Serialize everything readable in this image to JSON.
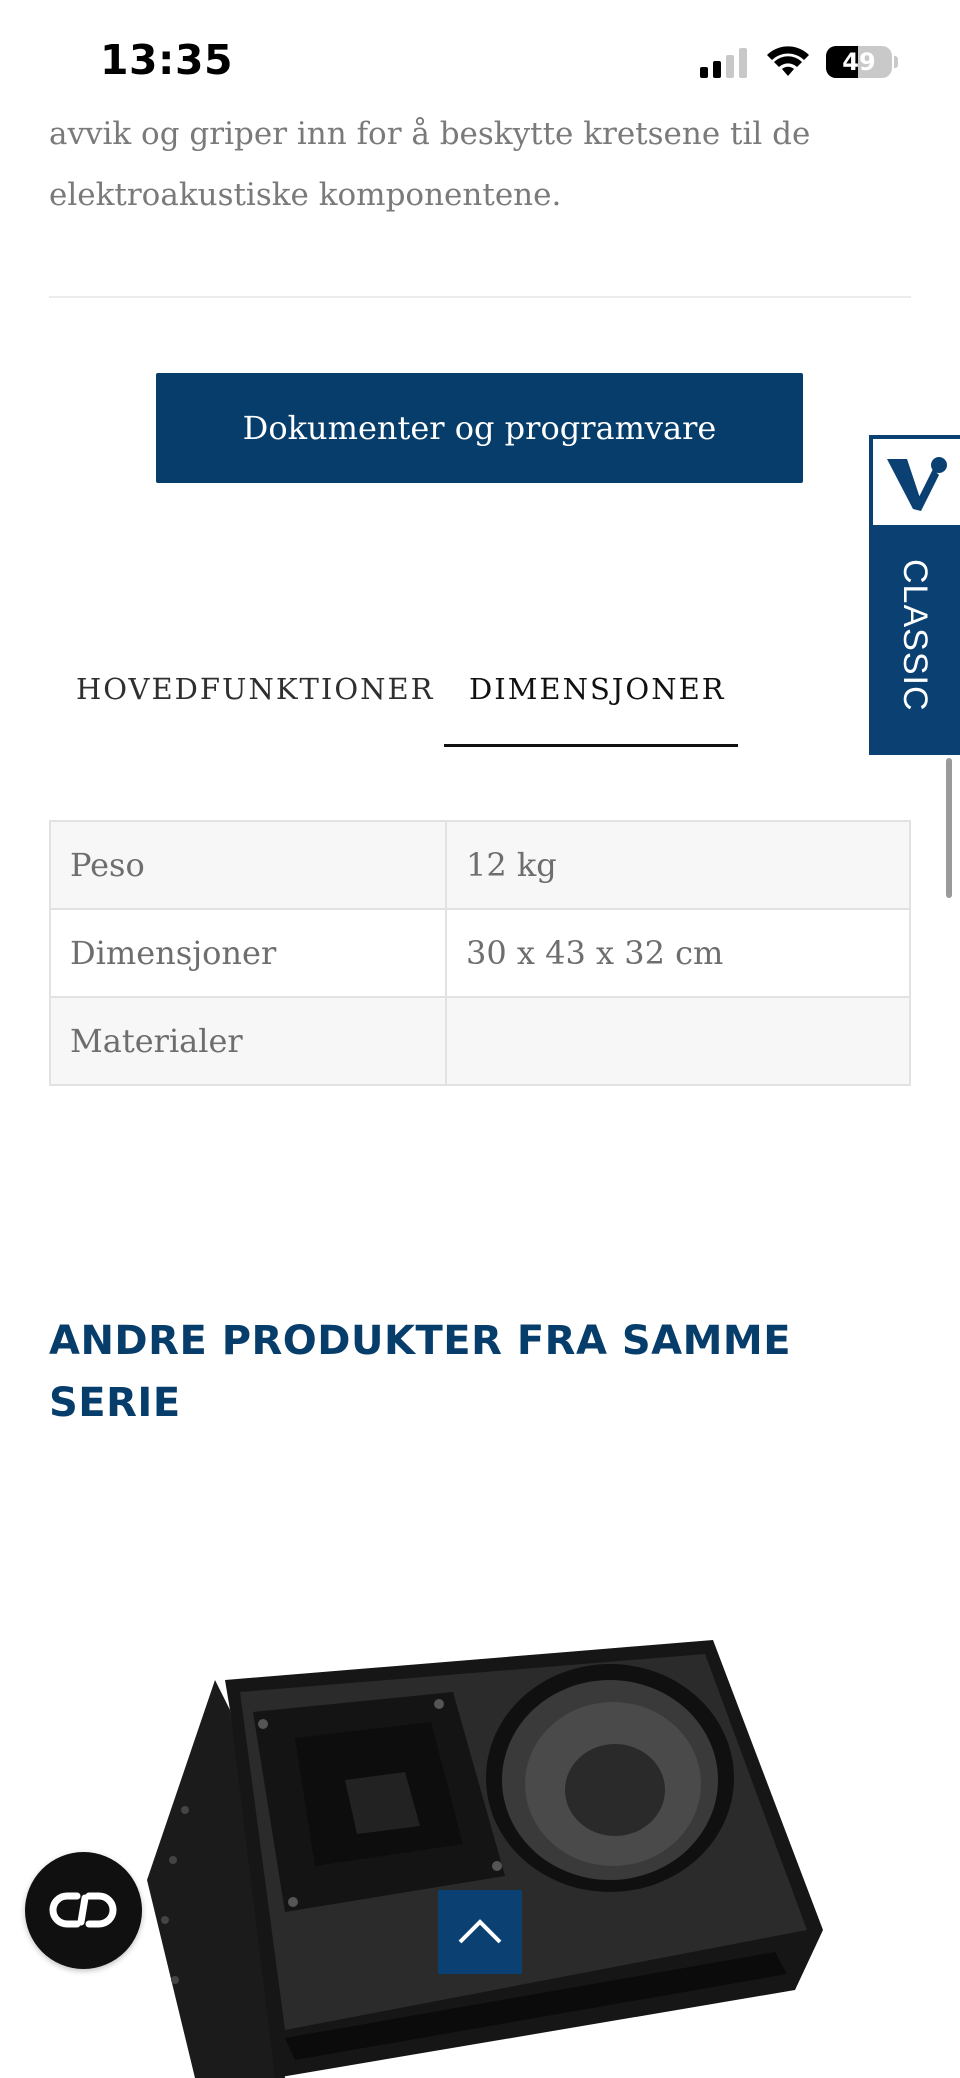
{
  "status_bar": {
    "time": "13:35",
    "battery_level": "49"
  },
  "intro": {
    "text": "avvik og griper inn for å beskytte kretsene til de elektroakustiske komponentene."
  },
  "documents_button": {
    "label": "Dokumenter og programvare"
  },
  "brand_badge": {
    "label": "CLASSIC",
    "logo_icon": "v-logo-icon"
  },
  "tabs": [
    {
      "label": "HOVEDFUNKTIONER",
      "active": false
    },
    {
      "label": "DIMENSJONER",
      "active": true
    }
  ],
  "specs": {
    "rows": [
      {
        "key": "Peso",
        "value": "12 kg"
      },
      {
        "key": "Dimensjoner",
        "value": "30 x 43 x 32 cm"
      },
      {
        "key": "Materialer",
        "value": ""
      }
    ]
  },
  "related": {
    "heading": "ANDRE PRODUKTER FRA SAMME SERIE"
  },
  "chat_button": {
    "icon": "chat-link-icon"
  },
  "scroll_top_button": {
    "icon": "chevron-up-icon"
  },
  "colors": {
    "brand_blue": "#073d6b",
    "text_gray": "#7a7a7a",
    "table_border": "#e2e2e2"
  }
}
